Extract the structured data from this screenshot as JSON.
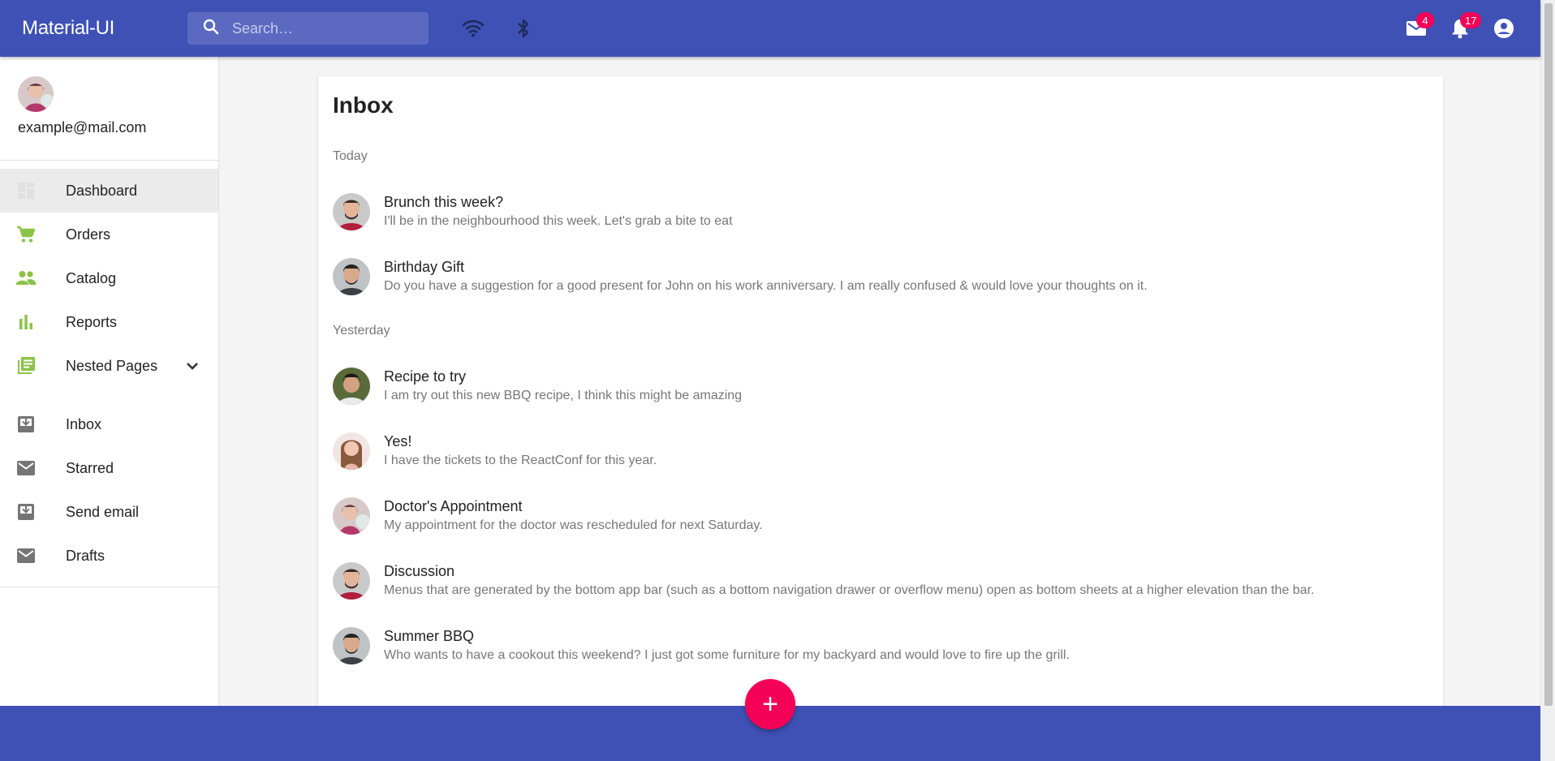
{
  "app": {
    "brand": "Material-UI",
    "search_placeholder": "Search…",
    "colors": {
      "primary": "#3f51b5",
      "accent": "#f50057",
      "nav_icon_green": "#8bc34a",
      "nav_icon_gray": "#757575"
    },
    "icons": [
      "search-icon",
      "wifi-icon",
      "bluetooth-icon",
      "mail-icon",
      "notifications-icon",
      "account-circle-icon"
    ],
    "mail_badge": "4",
    "notifications_badge": "17"
  },
  "sidebar": {
    "email": "example@mail.com",
    "items": [
      {
        "label": "Dashboard",
        "icon": "dashboard-icon",
        "active": true
      },
      {
        "label": "Orders",
        "icon": "cart-icon"
      },
      {
        "label": "Catalog",
        "icon": "people-icon"
      },
      {
        "label": "Reports",
        "icon": "bar-chart-icon"
      },
      {
        "label": "Nested Pages",
        "icon": "library-books-icon"
      }
    ],
    "secondary": [
      {
        "label": "Inbox",
        "icon": "inbox-icon"
      },
      {
        "label": "Starred",
        "icon": "mail-icon"
      },
      {
        "label": "Send email",
        "icon": "inbox-icon"
      },
      {
        "label": "Drafts",
        "icon": "mail-icon"
      }
    ]
  },
  "inbox": {
    "title": "Inbox",
    "today_label": "Today",
    "yesterday_label": "Yesterday",
    "messages": [
      {
        "title": "Brunch this week?",
        "body": "I'll be in the neighbourhood this week. Let's grab a bite to eat"
      },
      {
        "title": "Birthday Gift",
        "body": "Do you have a suggestion for a good present for John on his work anniversary. I am really confused & would love your thoughts on it."
      },
      {
        "title": "Recipe to try",
        "body": "I am try out this new BBQ recipe, I think this might be amazing"
      },
      {
        "title": "Yes!",
        "body": "I have the tickets to the ReactConf for this year."
      },
      {
        "title": "Doctor's Appointment",
        "body": "My appointment for the doctor was rescheduled for next Saturday."
      },
      {
        "title": "Discussion",
        "body": "Menus that are generated by the bottom app bar (such as a bottom navigation drawer or overflow menu) open as bottom sheets at a higher elevation than the bar."
      },
      {
        "title": "Summer BBQ",
        "body": "Who wants to have a cookout this weekend? I just got some furniture for my backyard and would love to fire up the grill."
      }
    ]
  },
  "fab": {
    "label": "+"
  }
}
